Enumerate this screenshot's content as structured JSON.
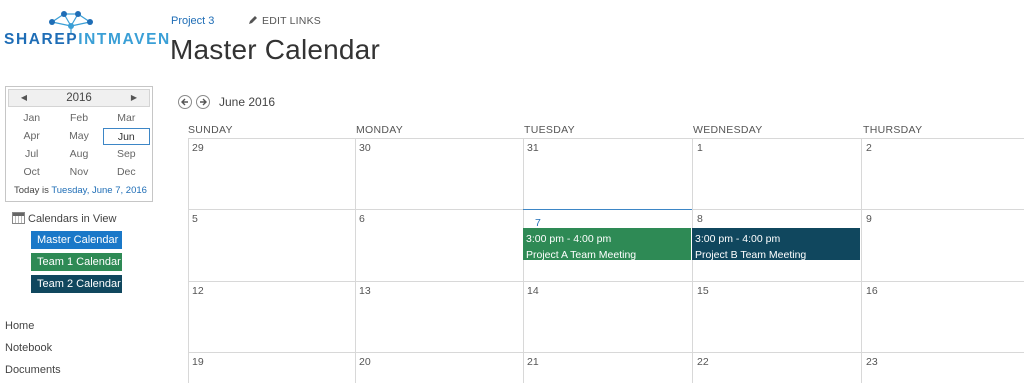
{
  "logo": {
    "text_a": "SHAREP",
    "text_b": "INT",
    "text_c": "MAVEN",
    "colors": {
      "dark": "#1e6db6",
      "light": "#3a9fd6"
    }
  },
  "header": {
    "breadcrumb": "Project 3",
    "edit_links": "EDIT LINKS",
    "title": "Master Calendar"
  },
  "date_picker": {
    "year": "2016",
    "prev_icon": "triangle-left-icon",
    "next_icon": "triangle-right-icon",
    "months": [
      "Jan",
      "Feb",
      "Mar",
      "Apr",
      "May",
      "Jun",
      "Jul",
      "Aug",
      "Sep",
      "Oct",
      "Nov",
      "Dec"
    ],
    "selected_month": "Jun",
    "today_prefix": "Today is ",
    "today_link": "Tuesday, June 7, 2016"
  },
  "calendars_in_view": {
    "label": "Calendars in View",
    "items": [
      {
        "label": "Master Calendar",
        "color": "#1a78c8"
      },
      {
        "label": "Team 1 Calendar",
        "color": "#2e8a55"
      },
      {
        "label": "Team 2 Calendar",
        "color": "#10475e"
      }
    ]
  },
  "nav": {
    "items": [
      "Home",
      "Notebook",
      "Documents"
    ]
  },
  "calendar": {
    "month_label": "June 2016",
    "day_names": [
      "SUNDAY",
      "MONDAY",
      "TUESDAY",
      "WEDNESDAY",
      "THURSDAY"
    ],
    "weeks": [
      [
        "29",
        "30",
        "31",
        "1",
        "2"
      ],
      [
        "5",
        "6",
        "7",
        "8",
        "9"
      ],
      [
        "12",
        "13",
        "14",
        "15",
        "16"
      ],
      [
        "19",
        "20",
        "21",
        "22",
        "23"
      ]
    ],
    "today_date": "7",
    "events": [
      {
        "time": "3:00 pm - 4:00 pm",
        "title": "Project A Team Meeting",
        "color": "#2e8a55"
      },
      {
        "time": "3:00 pm - 4:00 pm",
        "title": "Project B Team Meeting",
        "color": "#10475e"
      }
    ]
  }
}
